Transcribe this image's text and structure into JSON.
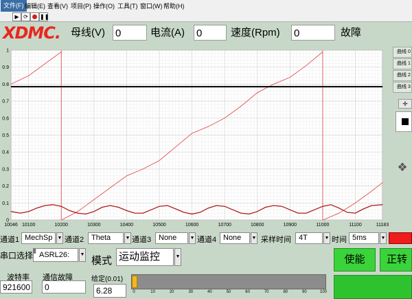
{
  "menu": [
    "文件(F)",
    "编辑(E)",
    "查看(V)",
    "项目(P)",
    "操作(O)",
    "工具(T)",
    "窗口(W)",
    "帮助(H)"
  ],
  "toolbar": {
    "icons": [
      "run-arrow-icon",
      "run-continuous-icon",
      "abort-icon",
      "pause-icon"
    ]
  },
  "header": {
    "logo": "XDMC.",
    "bus_label": "母线(V)",
    "bus_value": "0",
    "current_label": "电流(A)",
    "current_value": "0",
    "speed_label": "速度(Rpm)",
    "speed_value": "0",
    "fault_label": "故障"
  },
  "chart_data": {
    "type": "line",
    "xlim": [
      10046,
      11183
    ],
    "ylim": [
      0,
      1
    ],
    "x_tick_labels": [
      "10046",
      "10100",
      "10200",
      "10300",
      "10400",
      "10500",
      "10600",
      "10700",
      "10800",
      "10900",
      "11000",
      "11100",
      "11183"
    ],
    "y_tick_labels": [
      "0",
      "0.1",
      "0.2",
      "0.3",
      "0.4",
      "0.5",
      "0.6",
      "0.7",
      "0.8",
      "0.9",
      "1"
    ],
    "grid": true,
    "series": [
      {
        "color": "#e05050",
        "x": [
          10046,
          10100,
          10150,
          10200,
          10201,
          10250,
          10300,
          10350,
          10400,
          10450,
          10500,
          10550,
          10600,
          10650,
          10700,
          10750,
          10800,
          10850,
          10900,
          10950,
          11000,
          11001,
          11050,
          11100,
          11150,
          11183
        ],
        "y": [
          0.8,
          0.85,
          0.92,
          0.99,
          0.0,
          0.05,
          0.12,
          0.19,
          0.26,
          0.3,
          0.35,
          0.43,
          0.51,
          0.55,
          0.6,
          0.67,
          0.75,
          0.8,
          0.84,
          0.91,
          0.99,
          0.0,
          0.04,
          0.1,
          0.17,
          0.22
        ]
      },
      {
        "color": "#b01818",
        "x": [
          10046,
          10075,
          10100,
          10125,
          10150,
          10175,
          10200,
          10225,
          10250,
          10275,
          10300,
          10325,
          10350,
          10375,
          10400,
          10425,
          10450,
          10475,
          10500,
          10525,
          10550,
          10575,
          10600,
          10625,
          10650,
          10675,
          10700,
          10725,
          10750,
          10775,
          10800,
          10825,
          10850,
          10875,
          10900,
          10925,
          10950,
          10975,
          11000,
          11025,
          11050,
          11075,
          11100,
          11125,
          11150,
          11183
        ],
        "y": [
          0.05,
          0.04,
          0.05,
          0.07,
          0.085,
          0.09,
          0.08,
          0.055,
          0.04,
          0.035,
          0.05,
          0.075,
          0.085,
          0.075,
          0.055,
          0.04,
          0.04,
          0.06,
          0.08,
          0.085,
          0.065,
          0.045,
          0.035,
          0.045,
          0.07,
          0.085,
          0.08,
          0.06,
          0.04,
          0.035,
          0.05,
          0.075,
          0.085,
          0.08,
          0.06,
          0.04,
          0.04,
          0.06,
          0.08,
          0.09,
          0.07,
          0.045,
          0.04,
          0.065,
          0.085,
          0.09
        ]
      },
      {
        "color": "#000000",
        "x": [
          10046,
          11183
        ],
        "y": [
          0.785,
          0.785
        ]
      }
    ],
    "vertical_markers": [
      10200,
      11000
    ]
  },
  "right_panel": {
    "legend": [
      "曲线 0",
      "曲线 1",
      "曲线 2",
      "曲线 3"
    ],
    "zoom_icons": [
      "cursor-tool-icon",
      "zoom-tool-icon",
      "pan-tool-icon"
    ]
  },
  "controls": {
    "ch1_label": "通道1",
    "ch1_value": "MechSp",
    "ch2_label": "通道2",
    "ch2_value": "Theta",
    "ch3_label": "通道3",
    "ch3_value": "None",
    "ch4_label": "通道4",
    "ch4_value": "None",
    "sample_label": "采样时间",
    "sample_value": "4T",
    "time_label": "时间",
    "time_value": "5ms"
  },
  "bottom": {
    "serial_label": "串口选择",
    "serial_value": "ASRL26:",
    "baud_label": "波特率",
    "baud_value": "921600",
    "comm_fault_label": "通信故障",
    "comm_fault_value": "0",
    "mode_label": "模式",
    "mode_value": "运动监控",
    "set_label": "给定(0.01)",
    "set_value": "6.28",
    "slider_value": 3,
    "slider_ticks": [
      "0",
      "10",
      "20",
      "30",
      "40",
      "50",
      "60",
      "70",
      "80",
      "90",
      "100"
    ],
    "enable_label": "使能",
    "forward_label": "正转"
  }
}
